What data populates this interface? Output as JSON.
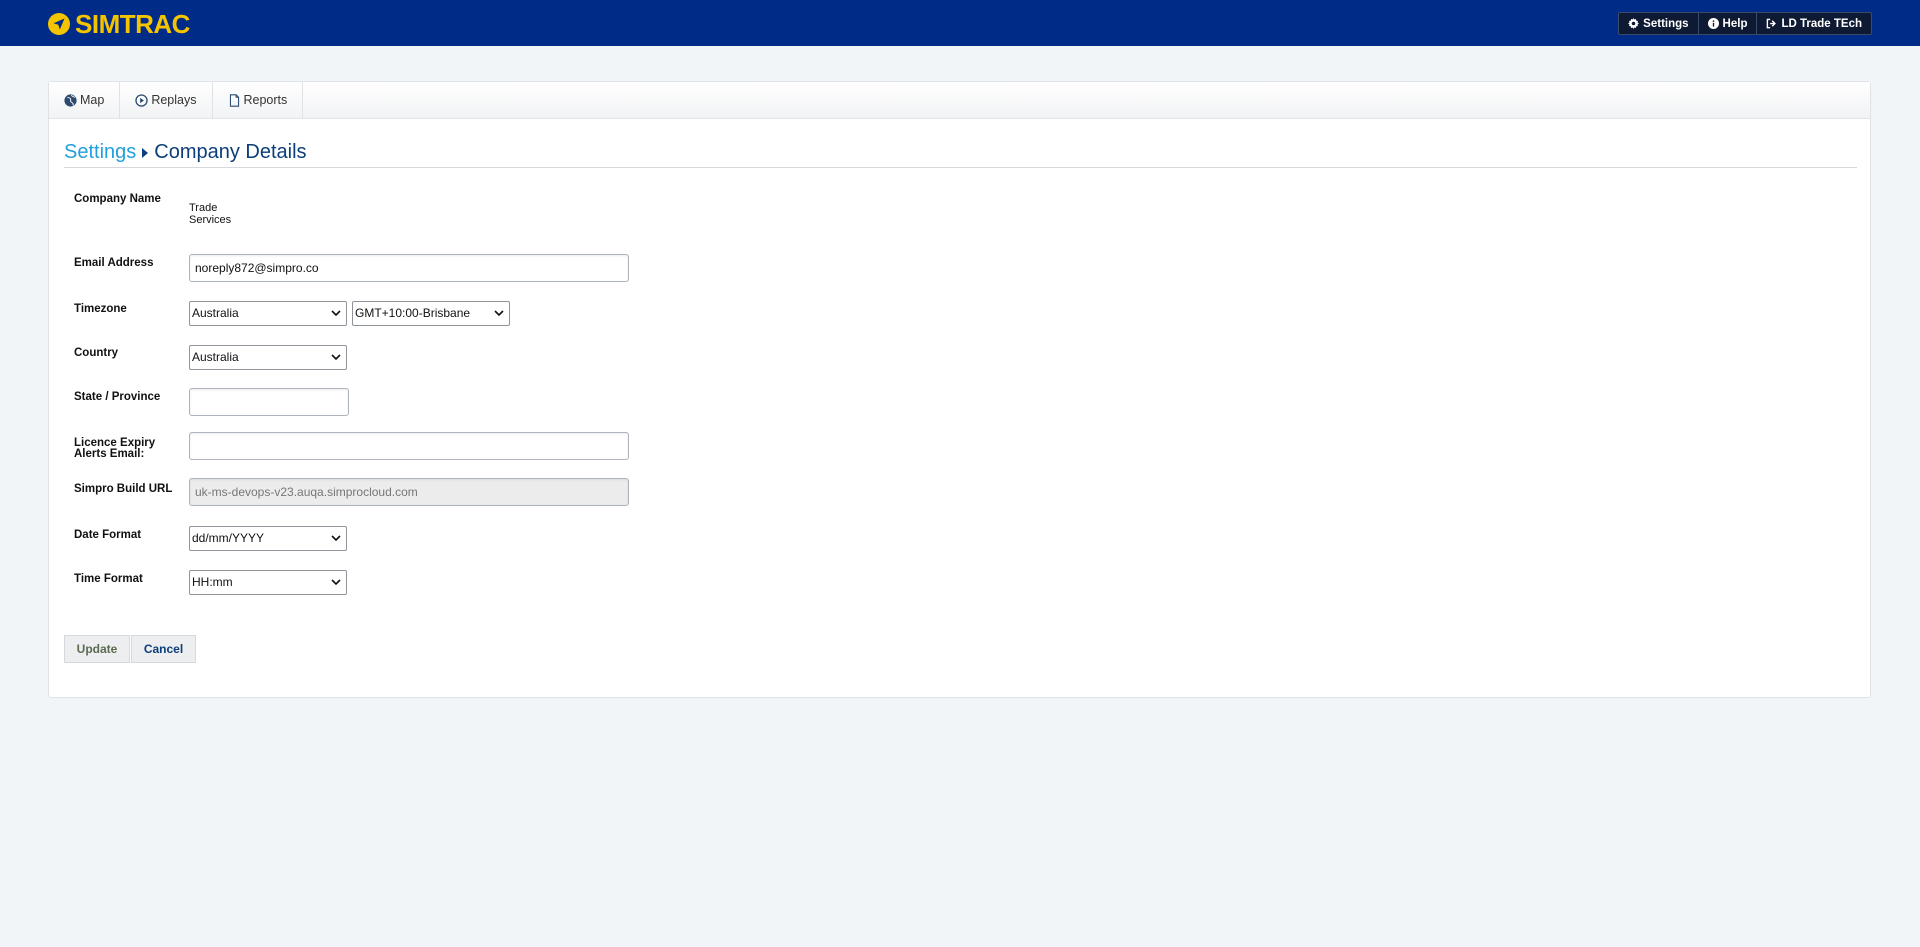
{
  "header": {
    "app_name": "SIMTRAC",
    "nav": [
      {
        "label": "Settings",
        "icon": "gear-icon"
      },
      {
        "label": "Help",
        "icon": "info-icon"
      },
      {
        "label": "LD Trade TEch",
        "icon": "sign-out-icon"
      }
    ],
    "brand_color": "#002b87",
    "logo_color": "#f5c400"
  },
  "tabs": [
    {
      "label": "Map",
      "icon": "globe-icon"
    },
    {
      "label": "Replays",
      "icon": "play-circle-icon"
    },
    {
      "label": "Reports",
      "icon": "file-icon"
    }
  ],
  "breadcrumb": {
    "parent": "Settings",
    "current": "Company Details"
  },
  "form": {
    "company_name": {
      "label": "Company Name",
      "value": "Trade Services"
    },
    "email": {
      "label": "Email Address",
      "value": "noreply872@simpro.co"
    },
    "timezone": {
      "label": "Timezone",
      "region": "Australia",
      "zone": "GMT+10:00-Brisbane"
    },
    "country": {
      "label": "Country",
      "value": "Australia"
    },
    "state": {
      "label": "State / Province",
      "value": ""
    },
    "licence_email": {
      "label_line1": "Licence Expiry",
      "label_line2": "Alerts Email:",
      "value": ""
    },
    "build_url": {
      "label": "Simpro Build URL",
      "value": "uk-ms-devops-v23.auqa.simprocloud.com"
    },
    "date_format": {
      "label": "Date Format",
      "value": "dd/mm/YYYY"
    },
    "time_format": {
      "label": "Time Format",
      "value": "HH:mm"
    }
  },
  "actions": {
    "update_label": "Update",
    "cancel_label": "Cancel"
  }
}
